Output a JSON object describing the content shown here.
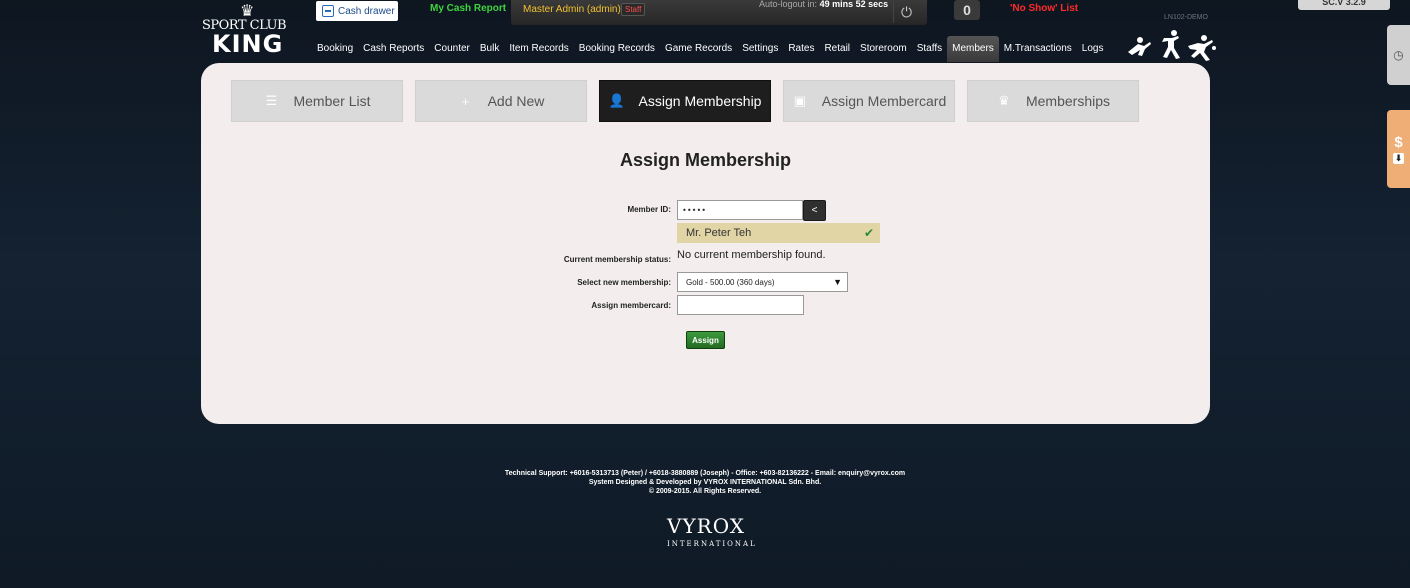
{
  "brand": {
    "logo_line1": "SPORT CLUB",
    "logo_line2": "KING",
    "logo_icon": "crown-icon"
  },
  "header": {
    "cash_drawer_label": "Cash drawer",
    "my_cash_report": "My Cash Report",
    "admin_name": "Master Admin (admin)",
    "admin_role": "Staff",
    "logout_prefix": "Auto-logout in:",
    "logout_time": "49 mins 52 secs",
    "counter_value": "0",
    "no_show": "'No Show' List",
    "site_code": "LN102-DEMO",
    "version": "SC.V 3.2.9"
  },
  "nav": {
    "items": [
      "Booking",
      "Cash Reports",
      "Counter",
      "Bulk",
      "Item Records",
      "Booking Records",
      "Game Records",
      "Settings",
      "Rates",
      "Retail",
      "Storeroom",
      "Staffs",
      "Members",
      "M.Transactions",
      "Logs"
    ],
    "active": "Members"
  },
  "tabs": [
    {
      "label": "Member List",
      "icon": "list-icon"
    },
    {
      "label": "Add New",
      "icon": "plus-icon"
    },
    {
      "label": "Assign Membership",
      "icon": "user-icon",
      "active": true
    },
    {
      "label": "Assign Membercard",
      "icon": "card-icon"
    },
    {
      "label": "Memberships",
      "icon": "crown-icon"
    }
  ],
  "form": {
    "title": "Assign Membership",
    "member_id_label": "Member ID:",
    "member_id_value": "•••••",
    "back_label": "<",
    "member_found": "Mr. Peter Teh",
    "status_label": "Current membership status:",
    "status_value": "No current membership found.",
    "select_label": "Select new membership:",
    "select_value": "Gold - 500.00 (360 days)",
    "membercard_label": "Assign membercard:",
    "membercard_value": "",
    "assign_button": "Assign"
  },
  "footer": {
    "line1": "Technical Support: +6016-5313713 (Peter) / +6018-3880889 (Joseph) - Office: +603-82136222 - Email: enquiry@vyrox.com",
    "line2": "System Designed & Developed by VYROX INTERNATIONAL Sdn. Bhd.",
    "line3": "© 2009-2015. All Rights Reserved.",
    "vyrox_logo": "VYROX",
    "vyrox_sub": "INTERNATIONAL"
  }
}
